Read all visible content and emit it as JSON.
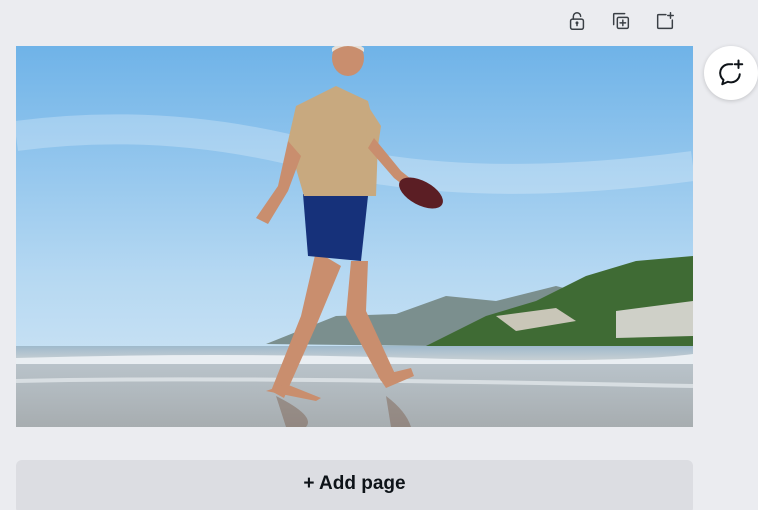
{
  "toolbar": {
    "lock_icon": "unlock-icon",
    "duplicate_icon": "duplicate-page-icon",
    "add_icon": "add-page-icon"
  },
  "page": {
    "image_subject": "beach-walk-photo"
  },
  "comment": {
    "icon": "add-comment-icon"
  },
  "add_page": {
    "label": "+ Add page"
  },
  "colors": {
    "background": "#ebecf0",
    "add_page_bg": "#dcdde2",
    "icon": "#3a3f45",
    "sky": "#8fc4ea",
    "text": "#0e1318"
  }
}
